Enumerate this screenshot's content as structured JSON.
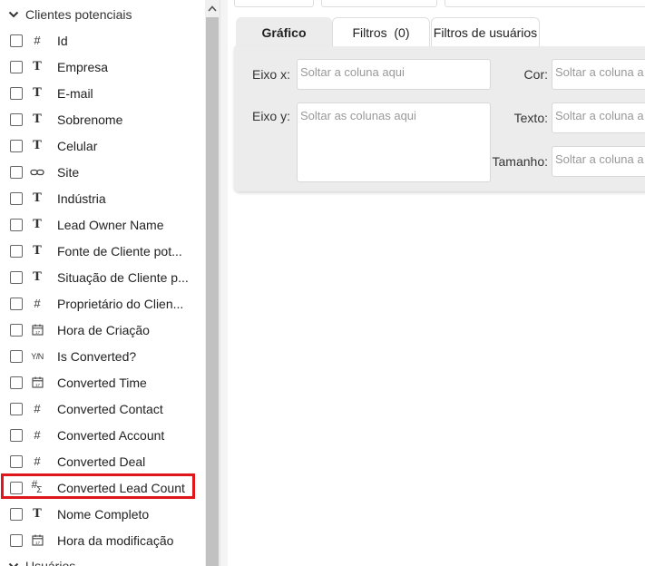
{
  "field_list": {
    "group_label": "Clientes potenciais",
    "fields": [
      {
        "icon": "hash-icon",
        "glyph": "#",
        "label": "Id"
      },
      {
        "icon": "text-type-icon",
        "glyph": "T",
        "label": "Empresa"
      },
      {
        "icon": "text-type-icon",
        "glyph": "T",
        "label": "E-mail"
      },
      {
        "icon": "text-type-icon",
        "glyph": "T",
        "label": "Sobrenome"
      },
      {
        "icon": "text-type-icon",
        "glyph": "T",
        "label": "Celular"
      },
      {
        "icon": "link-icon",
        "glyph": "",
        "label": "Site"
      },
      {
        "icon": "text-type-icon",
        "glyph": "T",
        "label": "Indústria"
      },
      {
        "icon": "text-type-icon",
        "glyph": "T",
        "label": "Lead Owner Name"
      },
      {
        "icon": "text-type-icon",
        "glyph": "T",
        "label": "Fonte de Cliente pot..."
      },
      {
        "icon": "text-type-icon",
        "glyph": "T",
        "label": "Situação de Cliente p..."
      },
      {
        "icon": "hash-icon",
        "glyph": "#",
        "label": "Proprietário do Clien..."
      },
      {
        "icon": "calendar-icon",
        "glyph": "",
        "label": "Hora de Criação"
      },
      {
        "icon": "yes-no-icon",
        "glyph": "Y/N",
        "label": "Is Converted?"
      },
      {
        "icon": "calendar-icon",
        "glyph": "",
        "label": "Converted Time"
      },
      {
        "icon": "hash-icon",
        "glyph": "#",
        "label": "Converted Contact"
      },
      {
        "icon": "hash-icon",
        "glyph": "#",
        "label": "Converted Account"
      },
      {
        "icon": "hash-icon",
        "glyph": "#",
        "label": "Converted Deal"
      },
      {
        "icon": "hash-sum-icon",
        "glyph": "#Σ",
        "label": "Converted Lead Count"
      },
      {
        "icon": "text-type-icon",
        "glyph": "T",
        "label": "Nome Completo"
      },
      {
        "icon": "calendar-icon",
        "glyph": "",
        "label": "Hora da modificação"
      }
    ],
    "next_group_label": "Usuários",
    "highlight_color": "#e0161d"
  },
  "tabs": [
    {
      "label": "Gráfico",
      "active": true
    },
    {
      "label": "Filtros  (0)",
      "active": false
    },
    {
      "label": "Filtros de usuários",
      "active": false
    }
  ],
  "config": {
    "x_axis_label": "Eixo x:",
    "x_axis_placeholder": "Soltar a coluna aqui",
    "y_axis_label": "Eixo y:",
    "y_axis_placeholder": "Soltar as colunas aqui",
    "color_label": "Cor:",
    "color_placeholder": "Soltar a coluna a",
    "text_label": "Texto:",
    "text_placeholder": "Soltar a coluna a",
    "size_label": "Tamanho:",
    "size_placeholder": "Soltar a coluna a"
  }
}
